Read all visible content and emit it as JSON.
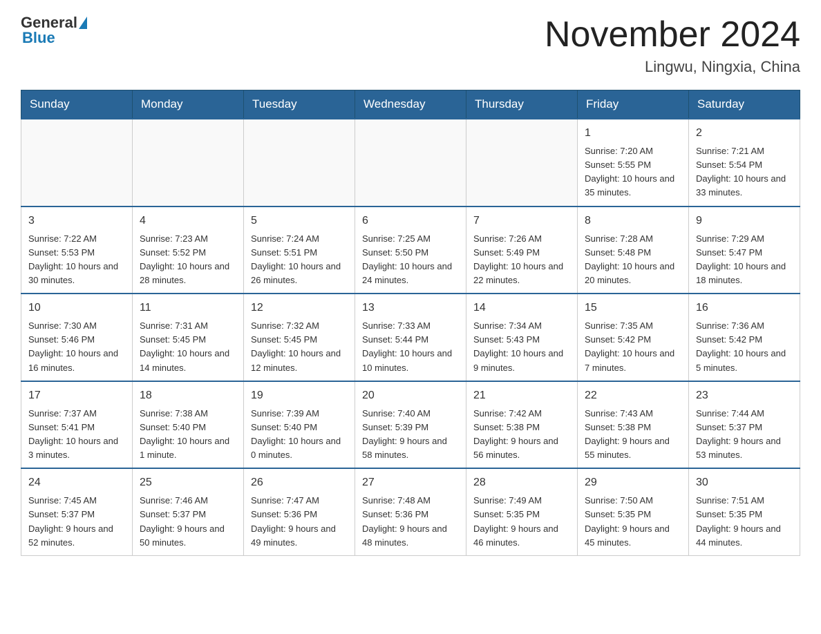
{
  "header": {
    "logo_general": "General",
    "logo_blue": "Blue",
    "title": "November 2024",
    "subtitle": "Lingwu, Ningxia, China"
  },
  "days_of_week": [
    "Sunday",
    "Monday",
    "Tuesday",
    "Wednesday",
    "Thursday",
    "Friday",
    "Saturday"
  ],
  "weeks": [
    [
      {
        "day": "",
        "info": ""
      },
      {
        "day": "",
        "info": ""
      },
      {
        "day": "",
        "info": ""
      },
      {
        "day": "",
        "info": ""
      },
      {
        "day": "",
        "info": ""
      },
      {
        "day": "1",
        "info": "Sunrise: 7:20 AM\nSunset: 5:55 PM\nDaylight: 10 hours and 35 minutes."
      },
      {
        "day": "2",
        "info": "Sunrise: 7:21 AM\nSunset: 5:54 PM\nDaylight: 10 hours and 33 minutes."
      }
    ],
    [
      {
        "day": "3",
        "info": "Sunrise: 7:22 AM\nSunset: 5:53 PM\nDaylight: 10 hours and 30 minutes."
      },
      {
        "day": "4",
        "info": "Sunrise: 7:23 AM\nSunset: 5:52 PM\nDaylight: 10 hours and 28 minutes."
      },
      {
        "day": "5",
        "info": "Sunrise: 7:24 AM\nSunset: 5:51 PM\nDaylight: 10 hours and 26 minutes."
      },
      {
        "day": "6",
        "info": "Sunrise: 7:25 AM\nSunset: 5:50 PM\nDaylight: 10 hours and 24 minutes."
      },
      {
        "day": "7",
        "info": "Sunrise: 7:26 AM\nSunset: 5:49 PM\nDaylight: 10 hours and 22 minutes."
      },
      {
        "day": "8",
        "info": "Sunrise: 7:28 AM\nSunset: 5:48 PM\nDaylight: 10 hours and 20 minutes."
      },
      {
        "day": "9",
        "info": "Sunrise: 7:29 AM\nSunset: 5:47 PM\nDaylight: 10 hours and 18 minutes."
      }
    ],
    [
      {
        "day": "10",
        "info": "Sunrise: 7:30 AM\nSunset: 5:46 PM\nDaylight: 10 hours and 16 minutes."
      },
      {
        "day": "11",
        "info": "Sunrise: 7:31 AM\nSunset: 5:45 PM\nDaylight: 10 hours and 14 minutes."
      },
      {
        "day": "12",
        "info": "Sunrise: 7:32 AM\nSunset: 5:45 PM\nDaylight: 10 hours and 12 minutes."
      },
      {
        "day": "13",
        "info": "Sunrise: 7:33 AM\nSunset: 5:44 PM\nDaylight: 10 hours and 10 minutes."
      },
      {
        "day": "14",
        "info": "Sunrise: 7:34 AM\nSunset: 5:43 PM\nDaylight: 10 hours and 9 minutes."
      },
      {
        "day": "15",
        "info": "Sunrise: 7:35 AM\nSunset: 5:42 PM\nDaylight: 10 hours and 7 minutes."
      },
      {
        "day": "16",
        "info": "Sunrise: 7:36 AM\nSunset: 5:42 PM\nDaylight: 10 hours and 5 minutes."
      }
    ],
    [
      {
        "day": "17",
        "info": "Sunrise: 7:37 AM\nSunset: 5:41 PM\nDaylight: 10 hours and 3 minutes."
      },
      {
        "day": "18",
        "info": "Sunrise: 7:38 AM\nSunset: 5:40 PM\nDaylight: 10 hours and 1 minute."
      },
      {
        "day": "19",
        "info": "Sunrise: 7:39 AM\nSunset: 5:40 PM\nDaylight: 10 hours and 0 minutes."
      },
      {
        "day": "20",
        "info": "Sunrise: 7:40 AM\nSunset: 5:39 PM\nDaylight: 9 hours and 58 minutes."
      },
      {
        "day": "21",
        "info": "Sunrise: 7:42 AM\nSunset: 5:38 PM\nDaylight: 9 hours and 56 minutes."
      },
      {
        "day": "22",
        "info": "Sunrise: 7:43 AM\nSunset: 5:38 PM\nDaylight: 9 hours and 55 minutes."
      },
      {
        "day": "23",
        "info": "Sunrise: 7:44 AM\nSunset: 5:37 PM\nDaylight: 9 hours and 53 minutes."
      }
    ],
    [
      {
        "day": "24",
        "info": "Sunrise: 7:45 AM\nSunset: 5:37 PM\nDaylight: 9 hours and 52 minutes."
      },
      {
        "day": "25",
        "info": "Sunrise: 7:46 AM\nSunset: 5:37 PM\nDaylight: 9 hours and 50 minutes."
      },
      {
        "day": "26",
        "info": "Sunrise: 7:47 AM\nSunset: 5:36 PM\nDaylight: 9 hours and 49 minutes."
      },
      {
        "day": "27",
        "info": "Sunrise: 7:48 AM\nSunset: 5:36 PM\nDaylight: 9 hours and 48 minutes."
      },
      {
        "day": "28",
        "info": "Sunrise: 7:49 AM\nSunset: 5:35 PM\nDaylight: 9 hours and 46 minutes."
      },
      {
        "day": "29",
        "info": "Sunrise: 7:50 AM\nSunset: 5:35 PM\nDaylight: 9 hours and 45 minutes."
      },
      {
        "day": "30",
        "info": "Sunrise: 7:51 AM\nSunset: 5:35 PM\nDaylight: 9 hours and 44 minutes."
      }
    ]
  ]
}
